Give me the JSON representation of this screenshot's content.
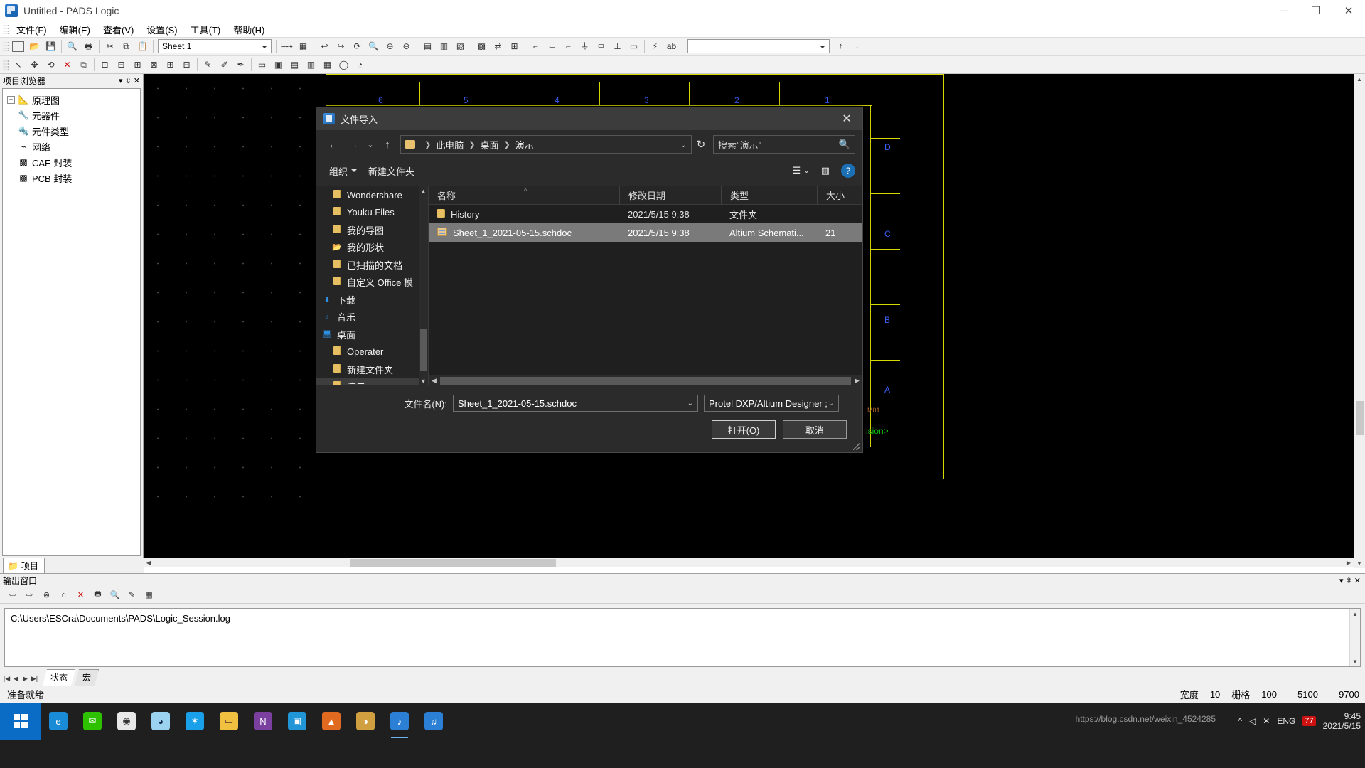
{
  "window": {
    "title": "Untitled - PADS Logic",
    "app_icon": "pads-logic-icon",
    "buttons": {
      "minimize": "─",
      "maximize": "❐",
      "close": "✕"
    }
  },
  "menubar": {
    "items": [
      {
        "label": "文件(F)"
      },
      {
        "label": "编辑(E)"
      },
      {
        "label": "查看(V)"
      },
      {
        "label": "设置(S)"
      },
      {
        "label": "工具(T)"
      },
      {
        "label": "帮助(H)"
      }
    ]
  },
  "toolbar": {
    "sheet_selector": "Sheet 1",
    "row1_icons": [
      "new-file-icon",
      "open-file-icon",
      "save-icon",
      "print-preview-icon",
      "print-icon",
      "cut-icon",
      "copy-icon",
      "paste-icon"
    ],
    "row1_icons_b": [
      "select-mode-icon",
      "zoom-board-icon",
      "undo-icon",
      "redo-icon",
      "redraw-icon",
      "search-icon",
      "zoom-in-icon",
      "zoom-out-icon"
    ],
    "row1_icons_c": [
      "sheet-icon",
      "page-icon",
      "field-icon",
      "netlist-icon",
      "back-annotate-icon",
      "ecad-icon",
      "layers-icon",
      "hierarchy-icon",
      "part-icon",
      "us1-icon",
      "u2-icon",
      "bus-icon",
      "connection-icon",
      "net-icon",
      "gnd-icon",
      "vcc-icon",
      "power-icon",
      "ground-icon",
      "off-page-icon",
      "text-icon",
      "attribute-icon"
    ],
    "row2_icons": [
      "pointer-icon",
      "move-icon",
      "rotate-icon",
      "delete-icon",
      "copy2-icon",
      "u1-u2-icon",
      "u1-in-icon",
      "u1-u2b-icon",
      "u3-icon",
      "u4-icon",
      "u5-icon",
      "add-part-icon",
      "add-conn-icon",
      "add-bus-icon",
      "label-icon",
      "attr-icon",
      "field2-icon",
      "text2-icon",
      "poly-icon",
      "circle-icon",
      "dim-icon"
    ],
    "nav_up": "↑",
    "nav_down": "↓"
  },
  "project_browser": {
    "title": "项目浏览器",
    "header_actions": [
      "dropdown-icon",
      "pin-icon",
      "close-icon"
    ],
    "tree": [
      {
        "label": "原理图",
        "icon": "schematic-icon",
        "expander": "+",
        "indent": 0
      },
      {
        "label": "元器件",
        "icon": "component-icon",
        "expander": "",
        "indent": 1
      },
      {
        "label": "元件类型",
        "icon": "parttype-icon",
        "expander": "",
        "indent": 1
      },
      {
        "label": "网络",
        "icon": "net-icon",
        "expander": "",
        "indent": 1
      },
      {
        "label": "CAE 封装",
        "icon": "cae-decal-icon",
        "expander": "",
        "indent": 1
      },
      {
        "label": "PCB 封装",
        "icon": "pcb-decal-icon",
        "expander": "",
        "indent": 1
      }
    ],
    "tab": "项目"
  },
  "canvas": {
    "ruler_numbers": [
      "6",
      "5",
      "4",
      "3",
      "2",
      "1"
    ],
    "zone_letters": [
      "D",
      "C",
      "B",
      "A"
    ],
    "revision_text": "ision>",
    "corner_label": "M01"
  },
  "output_window": {
    "title": "输出窗口",
    "header_actions": [
      "dropdown-icon",
      "pin-icon",
      "close-icon"
    ],
    "toolbar_icons": [
      "back-icon",
      "forward-icon",
      "stop-icon",
      "home-icon",
      "clear-icon",
      "print-icon",
      "find-icon",
      "edit-icon",
      "table-icon"
    ],
    "log_text": "C:\\Users\\ESCra\\Documents\\PADS\\Logic_Session.log",
    "nav_icons": [
      "first-icon",
      "prev-icon",
      "next-icon",
      "last-icon"
    ],
    "tabs": [
      {
        "label": "状态",
        "active": true
      },
      {
        "label": "宏",
        "active": false
      }
    ]
  },
  "statusbar": {
    "message": "准备就绪",
    "fields": [
      {
        "label": "宽度",
        "value": "10"
      },
      {
        "label": "栅格",
        "value": "100"
      }
    ],
    "coord_x": "-5100",
    "coord_y": "9700"
  },
  "dialog": {
    "title": "文件导入",
    "icon": "pads-import-icon",
    "close": "✕",
    "nav": {
      "back": "←",
      "forward": "→",
      "recent": "⌄",
      "up": "↑",
      "refresh": "↻"
    },
    "breadcrumb": [
      "此电脑",
      "桌面",
      "演示"
    ],
    "breadcrumb_chevron": "⌄",
    "search_placeholder": "搜索\"演示\"",
    "search_icon": "magnifier-icon",
    "commands": {
      "organize": "组织",
      "new_folder": "新建文件夹",
      "view_icon": "list-view-icon",
      "view_chevron": "⌄",
      "preview_icon": "preview-pane-icon",
      "help": "?"
    },
    "sidebar": [
      {
        "label": "Wondershare",
        "icon": "folder-icon",
        "indent": 1,
        "selected": false
      },
      {
        "label": "Youku Files",
        "icon": "folder-icon",
        "indent": 1,
        "selected": false
      },
      {
        "label": "我的导图",
        "icon": "folder-icon",
        "indent": 1,
        "selected": false
      },
      {
        "label": "我的形状",
        "icon": "shapes-folder-icon",
        "indent": 1,
        "selected": false
      },
      {
        "label": "已扫描的文档",
        "icon": "folder-icon",
        "indent": 1,
        "selected": false
      },
      {
        "label": "自定义 Office 模",
        "icon": "folder-icon",
        "indent": 1,
        "selected": false
      },
      {
        "label": "下载",
        "icon": "downloads-icon",
        "indent": 0,
        "selected": false
      },
      {
        "label": "音乐",
        "icon": "music-icon",
        "indent": 0,
        "selected": false
      },
      {
        "label": "桌面",
        "icon": "desktop-icon",
        "indent": 0,
        "selected": false
      },
      {
        "label": "Operater",
        "icon": "folder-icon",
        "indent": 1,
        "selected": false
      },
      {
        "label": "新建文件夹",
        "icon": "folder-icon",
        "indent": 1,
        "selected": false
      },
      {
        "label": "演示",
        "icon": "folder-icon",
        "indent": 1,
        "selected": true
      }
    ],
    "columns": [
      {
        "key": "name",
        "label": "名称",
        "sorted": true
      },
      {
        "key": "date",
        "label": "修改日期",
        "sorted": false
      },
      {
        "key": "type",
        "label": "类型",
        "sorted": false
      },
      {
        "key": "size",
        "label": "大小",
        "sorted": false
      }
    ],
    "files": [
      {
        "name": "History",
        "icon": "folder-icon",
        "date": "2021/5/15 9:38",
        "type": "文件夹",
        "size": "",
        "selected": false
      },
      {
        "name": "Sheet_1_2021-05-15.schdoc",
        "icon": "schdoc-icon",
        "date": "2021/5/15 9:38",
        "type": "Altium Schemati...",
        "size": "21",
        "selected": true
      }
    ],
    "filename_label": "文件名(N):",
    "filename_value": "Sheet_1_2021-05-15.schdoc",
    "filetype_value": "Protel DXP/Altium Designer ;",
    "chevron": "⌄",
    "open_button": "打开(O)",
    "cancel_button": "取消"
  },
  "taskbar": {
    "start_icon": "windows-start-icon",
    "apps": [
      {
        "name": "edge-icon",
        "color": "#1a8bd6",
        "glyph": "e"
      },
      {
        "name": "wechat-icon",
        "color": "#2dc100",
        "glyph": "✉"
      },
      {
        "name": "chrome-icon",
        "color": "#e8e8e8",
        "glyph": "◉"
      },
      {
        "name": "bird-icon",
        "color": "#9bd2f0",
        "glyph": "◕"
      },
      {
        "name": "tim-icon",
        "color": "#1aa0e8",
        "glyph": "✶"
      },
      {
        "name": "explorer-icon",
        "color": "#f0c040",
        "glyph": "▭"
      },
      {
        "name": "onenote-icon",
        "color": "#7b3fa0",
        "glyph": "N"
      },
      {
        "name": "store-icon",
        "color": "#2196d6",
        "glyph": "▣"
      },
      {
        "name": "flame-icon",
        "color": "#e06a20",
        "glyph": "▲"
      },
      {
        "name": "paint-icon",
        "color": "#d0a040",
        "glyph": "◑"
      },
      {
        "name": "pads-logic-icon",
        "color": "#2b7fd4",
        "glyph": "♪",
        "active": true
      },
      {
        "name": "pads-layout-icon",
        "color": "#2b7fd4",
        "glyph": "♫"
      }
    ],
    "tray": {
      "watermark": "https://blog.csdn.net/weixin_4524285",
      "badge": "77",
      "speaker": "◁",
      "mute": "✕",
      "ime": "ENG",
      "time": "9:45",
      "date": "2021/5/15"
    }
  }
}
